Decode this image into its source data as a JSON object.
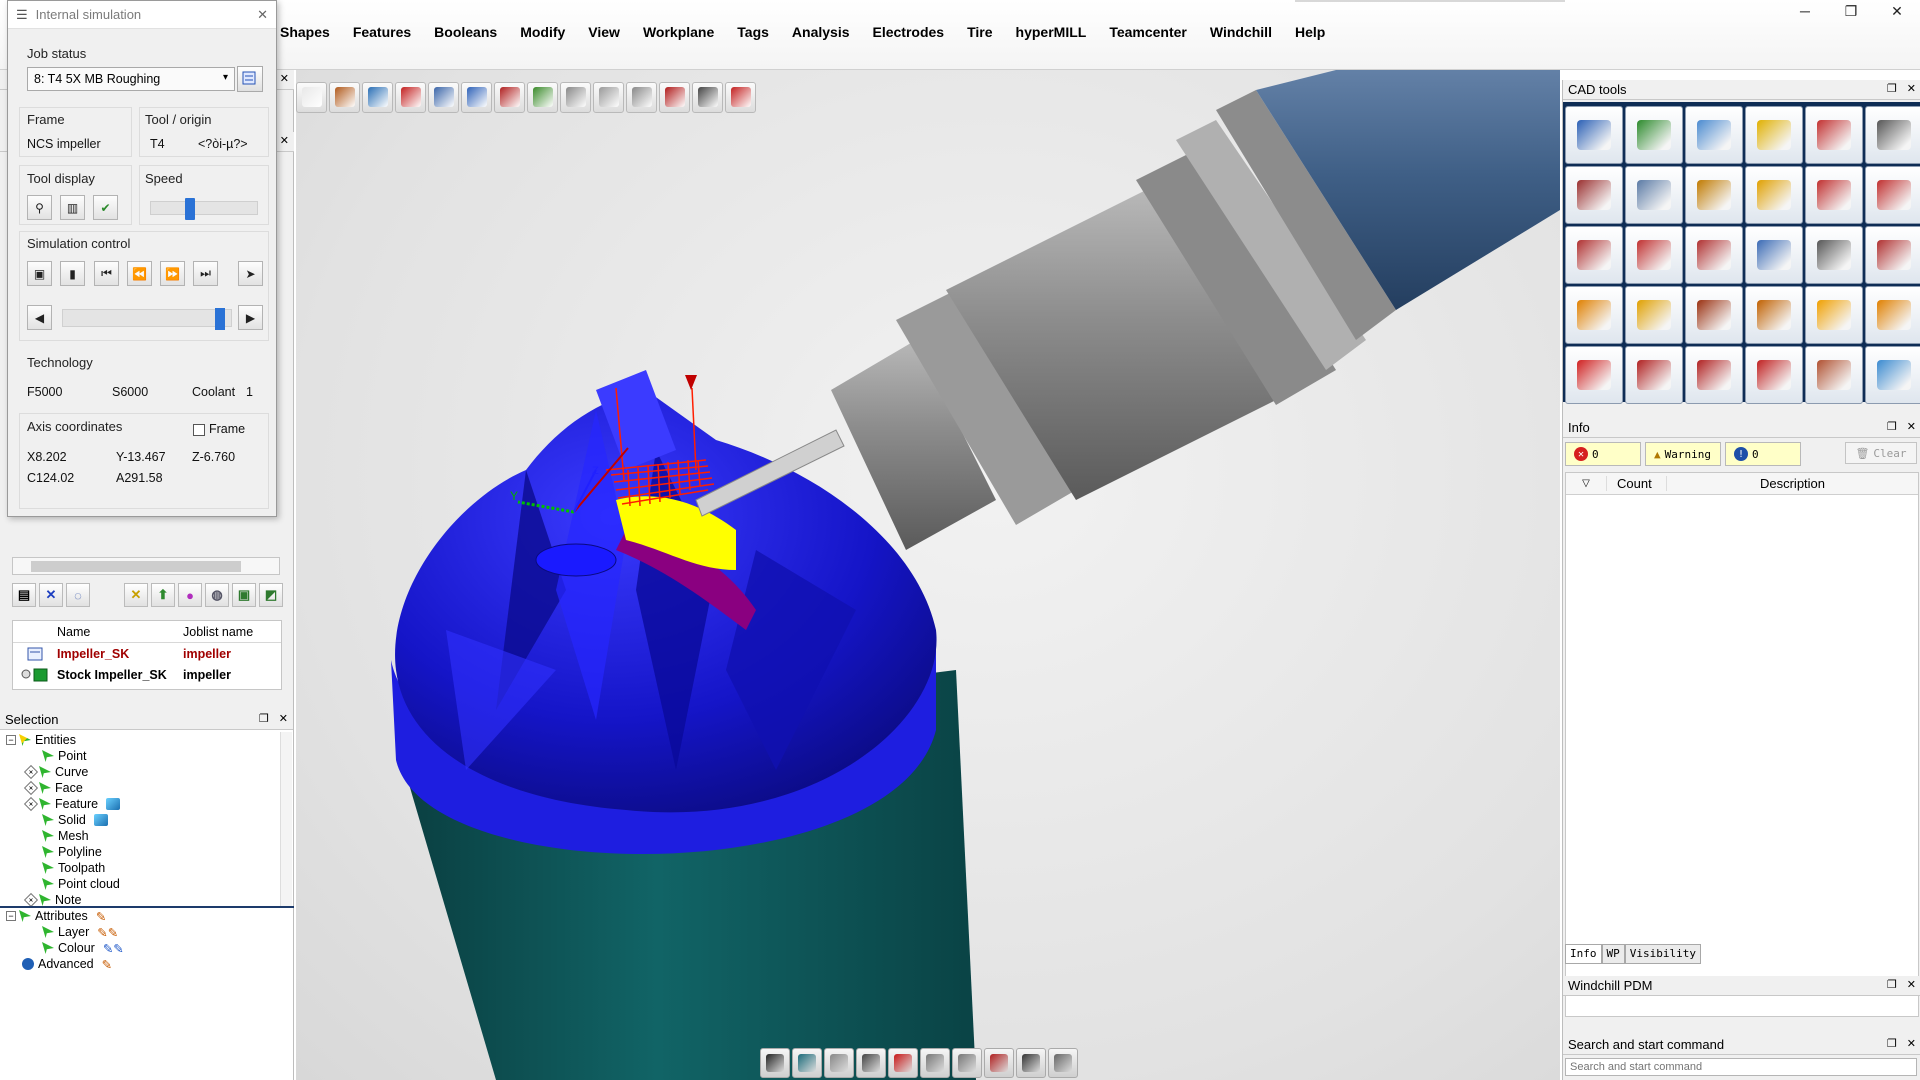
{
  "menu": {
    "items": [
      "Shapes",
      "Features",
      "Booleans",
      "Modify",
      "View",
      "Workplane",
      "Tags",
      "Analysis",
      "Electrodes",
      "Tire",
      "hyperMILL",
      "Teamcenter",
      "Windchill",
      "Help"
    ],
    "win_minimize": "─",
    "win_restore": "❐",
    "win_close": "✕"
  },
  "sim": {
    "title": "Internal simulation",
    "close": "✕",
    "job_status_label": "Job status",
    "job_selected": "8: T4 5X MB Roughing",
    "frame_label": "Frame",
    "frame_value": "NCS impeller",
    "tool_origin_label": "Tool / origin",
    "tool_value": "T4",
    "origin_value": "<?òi-µ?>",
    "tool_display_label": "Tool display",
    "speed_label": "Speed",
    "speed_level": 0.35,
    "sim_control_label": "Simulation control",
    "progress_level": 0.95,
    "technology_label": "Technology",
    "feed": "F5000",
    "spindle": "S6000",
    "coolant": "Coolant",
    "coolant_value": "1",
    "axis_label": "Axis coordinates",
    "frame_check_label": "Frame",
    "x": "X8.202",
    "y": "Y-13.467",
    "z": "Z-6.760",
    "c": "C124.02",
    "a": "A291.58"
  },
  "joblist": {
    "col_name": "Name",
    "col_job": "Joblist name",
    "rows": [
      {
        "name": "Impeller_SK",
        "job": "impeller",
        "color": "#a00000"
      },
      {
        "name": "Stock Impeller_SK",
        "job": "impeller",
        "color": "#000000"
      }
    ]
  },
  "selection": {
    "title": "Selection",
    "entities": "Entities",
    "items": [
      "Point",
      "Curve",
      "Face",
      "Feature",
      "Solid",
      "Mesh",
      "Polyline",
      "Toolpath",
      "Point cloud",
      "Note"
    ],
    "attributes": "Attributes",
    "attr_items": [
      "Layer",
      "Colour"
    ],
    "advanced": "Advanced"
  },
  "cad_tools": {
    "title": "CAD tools",
    "tools": [
      "import-i-icon",
      "2i-icon",
      "surface-plane-icon",
      "star-i-icon",
      "curve-point-icon",
      "fillet-curve-icon",
      "curve-d-icon",
      "plane-surface-icon",
      "hammer-surface-icon",
      "folded-surface-icon",
      "axis-curve-icon",
      "frame-curve-icon",
      "circle-r-icon",
      "wave-curve-icon",
      "spline-icon",
      "parallel-curve-icon",
      "box-wire-icon",
      "loft-icon",
      "offset-surface-icon",
      "swept-surface-icon",
      "fold-surface-icon",
      "revolve-icon",
      "blend-surface-icon",
      "drape-icon",
      "solid-box-icon",
      "pocket-solid-icon",
      "cylinder-solid-icon",
      "surface-solid-icon",
      "shell-icon",
      "glass-cube-icon"
    ]
  },
  "info": {
    "title": "Info",
    "errors": "0",
    "warning_label": "Warning",
    "info_count": "0",
    "clear": "Clear",
    "col_count": "Count",
    "col_desc": "Description",
    "tabs": [
      "Info",
      "WP",
      "Visibility"
    ]
  },
  "windchill": {
    "title": "Windchill PDM"
  },
  "search": {
    "title": "Search and start command",
    "placeholder": "Search and start command"
  },
  "colors": {
    "impeller": "#1a1ad8",
    "stock": "#0d5a5c",
    "toolpath": "#ff1e00",
    "yellow": "#ffff00",
    "accent": "#2a72d6"
  }
}
